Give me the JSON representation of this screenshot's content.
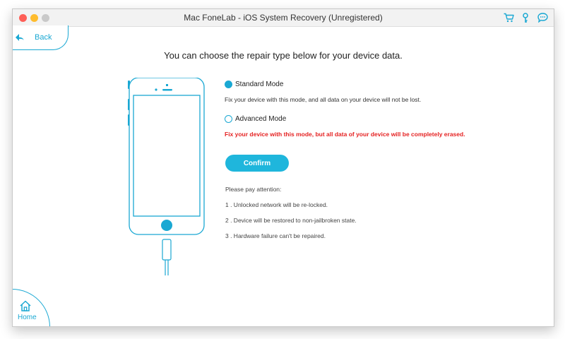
{
  "window": {
    "title": "Mac FoneLab - iOS System Recovery (Unregistered)"
  },
  "titlebar_icons": [
    "cart-icon",
    "key-icon",
    "chat-icon"
  ],
  "back": {
    "label": "Back"
  },
  "heading": "You can choose the repair type below for your device data.",
  "modes": [
    {
      "label": "Standard Mode",
      "selected": true,
      "description": "Fix your device with this mode, and all data on your device will not be lost."
    },
    {
      "label": "Advanced Mode",
      "selected": false,
      "description": "Fix your device with this mode, but all data of your device will be completely erased."
    }
  ],
  "confirm_label": "Confirm",
  "notes": {
    "title": "Please pay attention:",
    "items": [
      "1 . Unlocked network will be re-locked.",
      "2 . Device will be restored to non-jailbroken state.",
      "3 . Hardware failure can't be repaired."
    ]
  },
  "home": {
    "label": "Home"
  },
  "colors": {
    "accent": "#1fb6dc",
    "warning": "#e52222"
  }
}
